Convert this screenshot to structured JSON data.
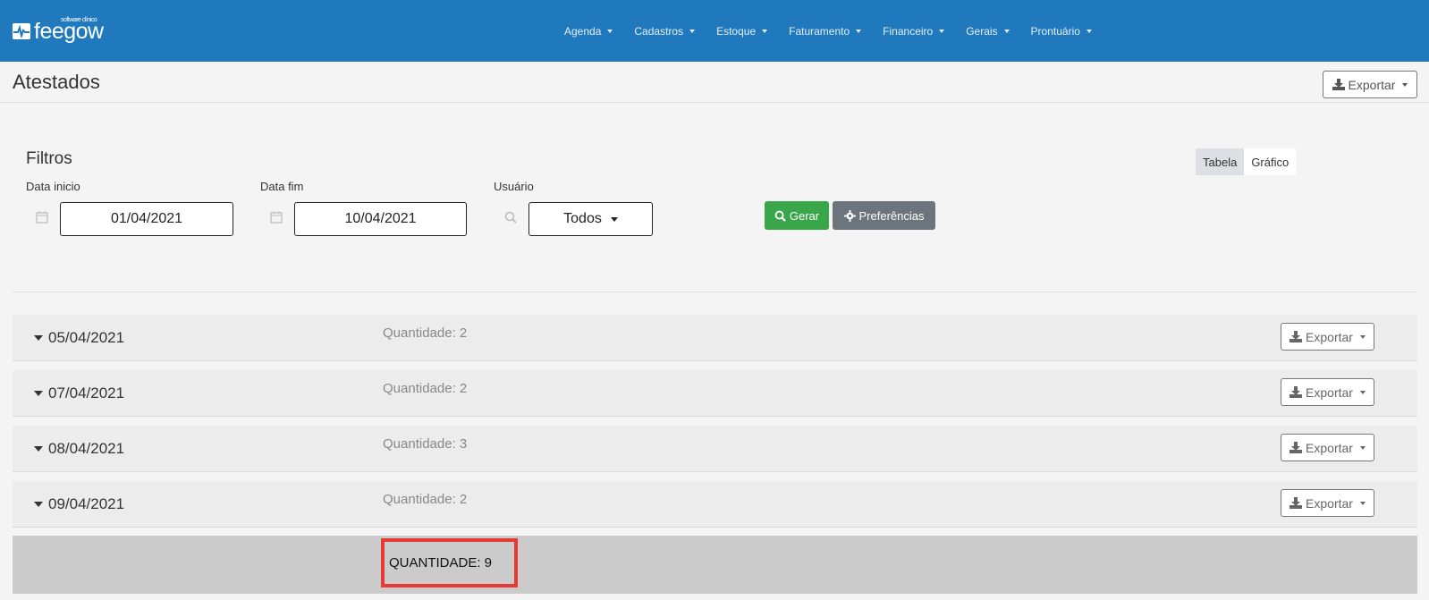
{
  "app": {
    "logo_text": "feegow",
    "logo_sub": "software clínico"
  },
  "nav": {
    "items": [
      "Agenda",
      "Cadastros",
      "Estoque",
      "Faturamento",
      "Financeiro",
      "Gerais",
      "Prontuário"
    ]
  },
  "page": {
    "title": "Atestados",
    "export_label": "Exportar"
  },
  "filters": {
    "heading": "Filtros",
    "data_inicio_label": "Data inicio",
    "data_inicio_value": "01/04/2021",
    "data_fim_label": "Data fim",
    "data_fim_value": "10/04/2021",
    "usuario_label": "Usuário",
    "usuario_value": "Todos",
    "gerar_label": "Gerar",
    "preferencias_label": "Preferências"
  },
  "view_toggle": {
    "tabela": "Tabela",
    "grafico": "Gráfico",
    "active": "Tabela"
  },
  "groups": [
    {
      "date": "05/04/2021",
      "quantity": "Quantidade: 2",
      "export_label": "Exportar"
    },
    {
      "date": "07/04/2021",
      "quantity": "Quantidade: 2",
      "export_label": "Exportar"
    },
    {
      "date": "08/04/2021",
      "quantity": "Quantidade: 3",
      "export_label": "Exportar"
    },
    {
      "date": "09/04/2021",
      "quantity": "Quantidade: 2",
      "export_label": "Exportar"
    }
  ],
  "total": {
    "label": "QUANTIDADE: 9"
  },
  "colors": {
    "topbar": "#2079bd",
    "gerar": "#3aa64a",
    "preferencias": "#6c757d",
    "highlight": "#e53935"
  },
  "icons": [
    "calendar-icon",
    "search-icon",
    "download-icon",
    "gear-icon",
    "caret-down-icon"
  ]
}
